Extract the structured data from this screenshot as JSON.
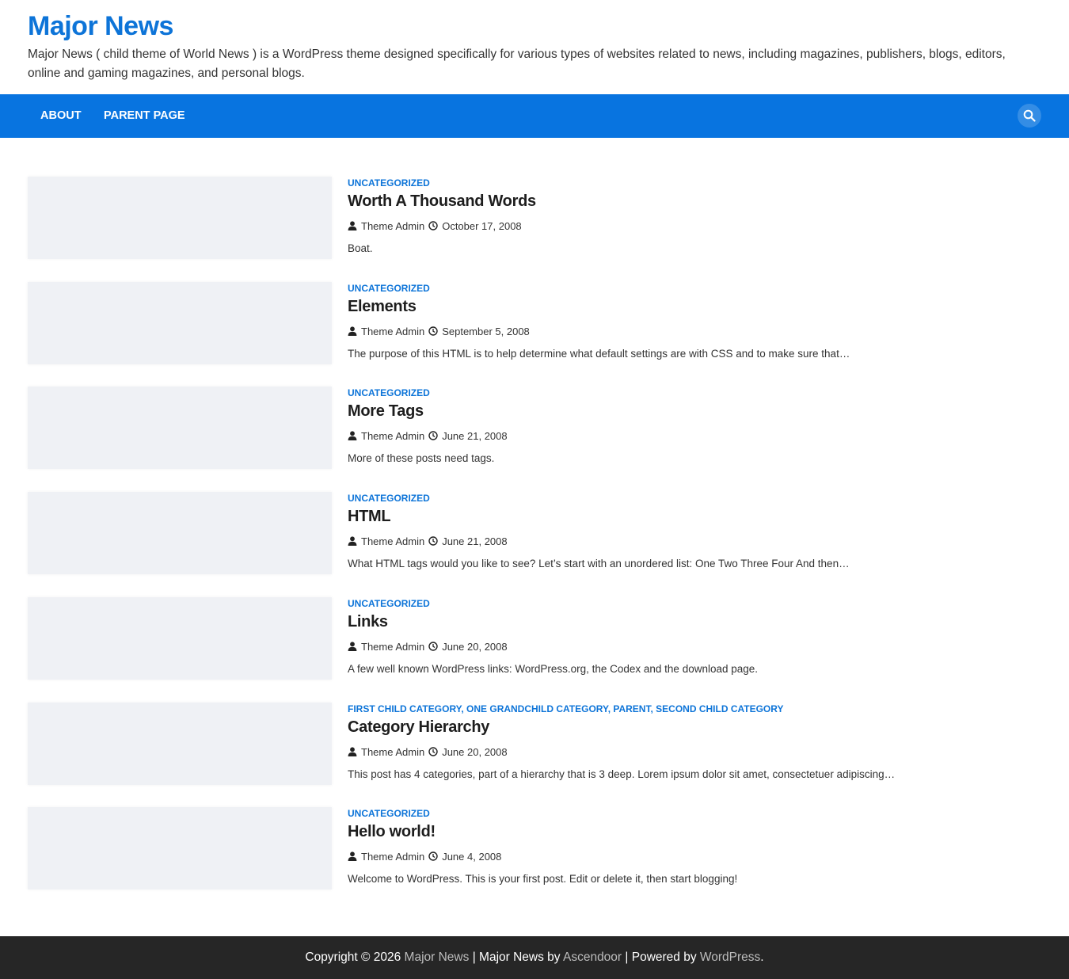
{
  "site": {
    "title": "Major News",
    "description": "Major News ( child theme of World News ) is a WordPress theme designed specifically for various types of websites related to news, including magazines, publishers, blogs, editors, online and gaming magazines, and personal blogs."
  },
  "nav": {
    "items": [
      {
        "label": "About"
      },
      {
        "label": "Parent Page"
      }
    ],
    "search_icon": "search-icon"
  },
  "posts": [
    {
      "categories": [
        "Uncategorized"
      ],
      "title": "Worth A Thousand Words",
      "author": "Theme Admin",
      "date": "October 17, 2008",
      "excerpt": "Boat."
    },
    {
      "categories": [
        "Uncategorized"
      ],
      "title": "Elements",
      "author": "Theme Admin",
      "date": "September 5, 2008",
      "excerpt": "The purpose of this HTML is to help determine what default settings are with CSS and to make sure that…"
    },
    {
      "categories": [
        "Uncategorized"
      ],
      "title": "More Tags",
      "author": "Theme Admin",
      "date": "June 21, 2008",
      "excerpt": "More of these posts need tags."
    },
    {
      "categories": [
        "Uncategorized"
      ],
      "title": "HTML",
      "author": "Theme Admin",
      "date": "June 21, 2008",
      "excerpt": "What HTML tags would you like to see? Let’s start with an unordered list: One Two Three Four And then…"
    },
    {
      "categories": [
        "Uncategorized"
      ],
      "title": "Links",
      "author": "Theme Admin",
      "date": "June 20, 2008",
      "excerpt": "A few well known WordPress links: WordPress.org, the Codex and the download page."
    },
    {
      "categories": [
        "First Child Category",
        "One Grandchild Category",
        "Parent",
        "Second Child Category"
      ],
      "title": "Category Hierarchy",
      "author": "Theme Admin",
      "date": "June 20, 2008",
      "excerpt": "This post has 4 categories, part of a hierarchy that is 3 deep. Lorem ipsum dolor sit amet, consectetuer adipiscing…"
    },
    {
      "categories": [
        "Uncategorized"
      ],
      "title": "Hello world!",
      "author": "Theme Admin",
      "date": "June 4, 2008",
      "excerpt": "Welcome to WordPress. This is your first post. Edit or delete it, then start blogging!"
    }
  ],
  "footer": {
    "copyright": "Copyright © 2026",
    "site_link": "Major News",
    "sep1": "|",
    "theme_text": "Major News by",
    "author_link": "Ascendoor",
    "sep2": "|",
    "powered_text": "Powered by",
    "wp_link": "WordPress",
    "end": "."
  },
  "colors": {
    "accent": "#0d74d8",
    "nav_bg": "#0874e0",
    "footer_bg": "#262626"
  }
}
